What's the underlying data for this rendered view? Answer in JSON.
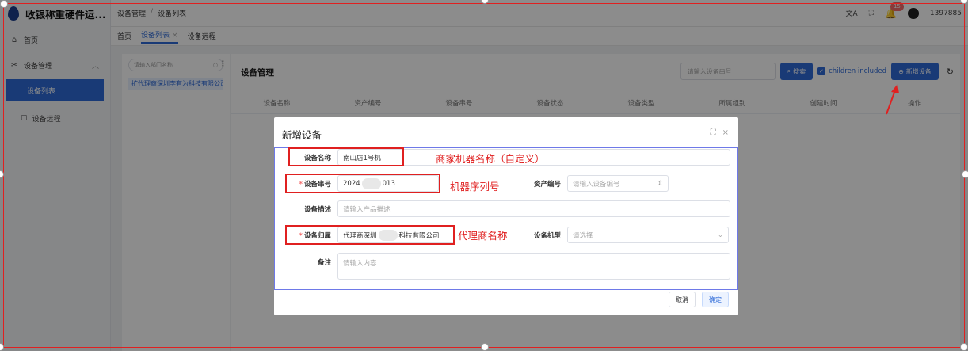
{
  "app": {
    "title": "收银称重硬件运..."
  },
  "sidebar": {
    "home_label": "首页",
    "group_label": "设备管理",
    "items": [
      {
        "label": "设备列表"
      },
      {
        "label": "设备远程"
      }
    ]
  },
  "header": {
    "breadcrumb": [
      "设备管理",
      "设备列表"
    ],
    "notification_count": "15",
    "user_label": "1397885"
  },
  "tabs": [
    {
      "label": "首页"
    },
    {
      "label": "设备列表"
    },
    {
      "label": "设备远程"
    }
  ],
  "tree": {
    "search_placeholder": "请输入部门名称",
    "node_label": "扩代理商深圳李有为科技有限公司"
  },
  "content": {
    "title": "设备管理",
    "search_placeholder": "请输入设备串号",
    "search_button": "搜索",
    "children_included": "children included",
    "add_button": "新增设备",
    "columns": [
      "设备名称",
      "资产编号",
      "设备串号",
      "设备状态",
      "设备类型",
      "所属组别",
      "创建时间",
      "操作"
    ]
  },
  "modal": {
    "title": "新增设备",
    "fields": {
      "name": {
        "label": "设备名称",
        "value": "南山店1号机"
      },
      "serial": {
        "label": "设备串号",
        "value_start": "2024",
        "value_end": "013"
      },
      "asset": {
        "label": "资产编号",
        "placeholder": "请输入设备编号"
      },
      "desc": {
        "label": "设备描述",
        "placeholder": "请输入产品描述"
      },
      "owner": {
        "label": "设备归属",
        "value_start": "代理商深圳",
        "value_end": "科技有限公司"
      },
      "model": {
        "label": "设备机型",
        "placeholder": "请选择"
      },
      "remark": {
        "label": "备注",
        "placeholder": "请输入内容"
      }
    },
    "cancel_button": "取消",
    "confirm_button": "确定"
  },
  "annotations": {
    "name_note": "商家机器名称（自定义）",
    "serial_note": "机器序列号",
    "owner_note": "代理商名称"
  },
  "colors": {
    "accent": "#2f6bd8",
    "annotation": "#e02020",
    "sidebar_active": "#2f6bd8"
  }
}
